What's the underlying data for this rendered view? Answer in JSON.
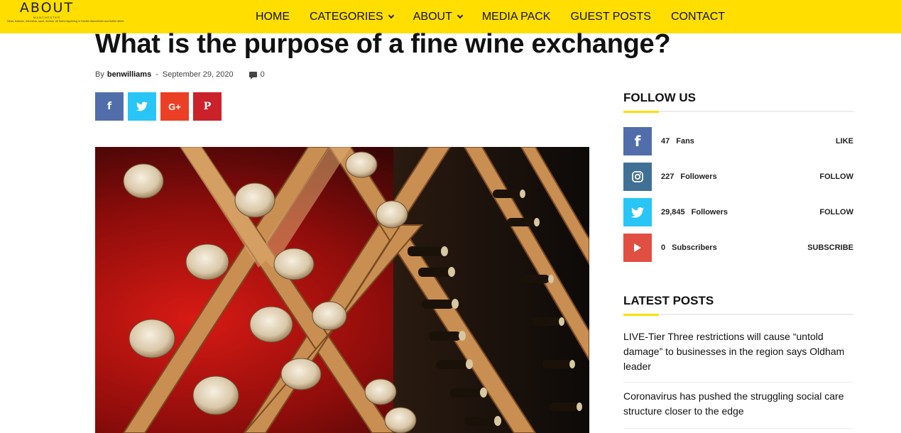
{
  "header": {
    "logo_text": "ABOUT",
    "logo_sub": "MANCHESTER",
    "logo_tagline": "News, features, interviews, sport, reviews. All that's happening in Greater Manchester and further afield.",
    "background": "#ffde00",
    "nav": [
      {
        "label": "HOME",
        "has_dropdown": false
      },
      {
        "label": "CATEGORIES",
        "has_dropdown": true
      },
      {
        "label": "ABOUT",
        "has_dropdown": true
      },
      {
        "label": "MEDIA PACK",
        "has_dropdown": false
      },
      {
        "label": "GUEST POSTS",
        "has_dropdown": false
      },
      {
        "label": "CONTACT",
        "has_dropdown": false
      }
    ]
  },
  "article": {
    "title": "What is the purpose of a fine wine exchange?",
    "by_label": "By",
    "author": "benwilliams",
    "separator": "-",
    "date": "September 29, 2020",
    "comment_count": "0",
    "share_buttons": [
      {
        "icon": "facebook-icon",
        "glyph": "f",
        "color": "#516eab"
      },
      {
        "icon": "twitter-icon",
        "glyph": "",
        "color": "#29c5f6"
      },
      {
        "icon": "google-plus-icon",
        "glyph": "G+",
        "color": "#eb4026"
      },
      {
        "icon": "pinterest-icon",
        "glyph": "P",
        "color": "#ca212a"
      }
    ],
    "hero_image": "wine-bottles-in-wooden-rack"
  },
  "sidebar": {
    "follow_title": "FOLLOW US",
    "social": [
      {
        "icon": "facebook-icon",
        "count": "47",
        "unit": "Fans",
        "action": "LIKE",
        "color": "#516eab"
      },
      {
        "icon": "instagram-icon",
        "count": "227",
        "unit": "Followers",
        "action": "FOLLOW",
        "color": "#417096"
      },
      {
        "icon": "twitter-icon",
        "count": "29,845",
        "unit": "Followers",
        "action": "FOLLOW",
        "color": "#29c5f6"
      },
      {
        "icon": "youtube-icon",
        "count": "0",
        "unit": "Subscribers",
        "action": "SUBSCRIBE",
        "color": "#e14e42"
      }
    ],
    "latest_title": "LATEST POSTS",
    "posts": [
      {
        "title": "LIVE-Tier Three restrictions will cause “untold damage” to businesses in the region says Oldham leader"
      },
      {
        "title": "Coronavirus has pushed the struggling social care structure closer to the edge"
      }
    ]
  }
}
